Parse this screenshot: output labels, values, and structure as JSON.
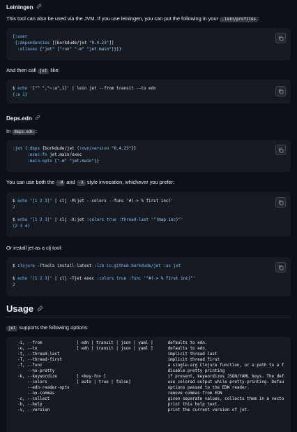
{
  "leiningen": {
    "heading": "Leiningen",
    "intro_a": "This tool can also be used via the JVM. If you use leiningen, you can put the following in your",
    "intro_code": ".lein/profiles",
    "intro_b": ":",
    "code": {
      "l1": "{:user",
      "l2a": " {:dependencies ",
      "l2b": "[[borkdude/jet ",
      "l2c": "\"0.4.23\"",
      "l2d": "]]",
      "l3a": "  :aliases ",
      "l3b": "{\"jet\" [\"run\" \"-m\" \"jet.main\"]}}}"
    },
    "then_a": "And then call",
    "then_code": "jet",
    "then_b": "like:",
    "code2": {
      "l1a": "$ ",
      "l1b": "echo",
      "l1c": " '[\"^ \",\"~:a\",1]' | lein jet --from transit --to edn",
      "l2": "{:a 1}"
    }
  },
  "deps": {
    "heading": "Deps.edn",
    "intro_a": "In",
    "intro_code": "deps.edn",
    "intro_b": ":",
    "code": {
      "l1a": ":jet ",
      "l1b": "{:deps ",
      "l1c": "{borkdude/jet ",
      "l1d": "{:mvn/version ",
      "l1e": "\"0.4.23\"",
      "l1f": "}}",
      "l2a": "      :exec-fn ",
      "l2b": "jet.main/exec",
      "l3a": "      :main-opts ",
      "l3b": "[\"-m\" \"jet.main\"]}"
    },
    "style_a": "You can use both the",
    "style_code1": "-M",
    "style_b": "and",
    "style_code2": "-X",
    "style_c": "style invocation, whichever you prefer:",
    "code2": {
      "l1a": "$ ",
      "l1b": "echo",
      "l1c": " '",
      "l1d": "[1 2 3]",
      "l1e": "' | clj -M:jet --colors --func '#(-> % first inc)'",
      "l2": "2",
      "l4a": "$ ",
      "l4b": "echo",
      "l4c": " '",
      "l4d": "[1 2 3]",
      "l4e": "' | clj -X:jet ",
      "l4f": ":colors true :thread-last ",
      "l4g": "'\"(map inc)\"'",
      "l5": "(2 3 4)"
    },
    "cljtool_text": "Or install jet as a clj tool:",
    "code3": {
      "l1a": "$ ",
      "l1b": "clojure",
      "l1c": " -Ttools install-latest ",
      "l1d": ":lib io.github.borkdude/jet :as jet",
      "l3a": "$ ",
      "l3b": "echo",
      "l3c": " '",
      "l3d": "[1 2 3]",
      "l3e": "' | clj -Tjet exec ",
      "l3f": ":colors true :func ",
      "l3g": "'\"#(-> % first inc)\"'",
      "l4": "2"
    }
  },
  "usage": {
    "heading": "Usage",
    "intro_code": "jet",
    "intro_b": "supports the following options:",
    "options": [
      {
        "flag": "  -i, --from",
        "arg": "[ edn | transit | json | yaml ]",
        "desc": "defaults to edn."
      },
      {
        "flag": "  -o, --to",
        "arg": "[ edn | transit | json | yaml ]",
        "desc": "defaults to edn."
      },
      {
        "flag": "  -t, --thread-last",
        "arg": "",
        "desc": "implicit thread last"
      },
      {
        "flag": "  -T, --thread-first",
        "arg": "",
        "desc": "implicit thread first"
      },
      {
        "flag": "  -f, --func",
        "arg": "",
        "desc": "a single-arg Clojure function, or a path to a file th"
      },
      {
        "flag": "      --no-pretty",
        "arg": "",
        "desc": "disable pretty printing"
      },
      {
        "flag": "  -k, --keywordize",
        "arg": "[ <key-fn> ]",
        "desc": "if present, keywordizes JSON/YAML keys. The default t"
      },
      {
        "flag": "      --colors",
        "arg": "[ auto | true | false]",
        "desc": "use colored output while pretty-printing. Defaults to"
      },
      {
        "flag": "      --edn-reader-opts",
        "arg": "",
        "desc": "options passed to the EDN reader."
      },
      {
        "flag": "      --no-commas",
        "arg": "",
        "desc": "remove commas from EDN"
      },
      {
        "flag": "  -c, --collect",
        "arg": "",
        "desc": "given separate values, collects them in a vector."
      },
      {
        "flag": "  -h, --help",
        "arg": "",
        "desc": "print this help text."
      },
      {
        "flag": "  -v, --version",
        "arg": "",
        "desc": "print the current version of jet."
      }
    ]
  },
  "icons": {
    "link": "link-icon",
    "copy": "copy-icon"
  },
  "colors": {
    "background": "#0d1117",
    "code_bg": "#161b22",
    "keyword": "#79c0ff",
    "string": "#a5d6ff",
    "accent_red": "#ff7b72",
    "text": "#e6edf3"
  }
}
